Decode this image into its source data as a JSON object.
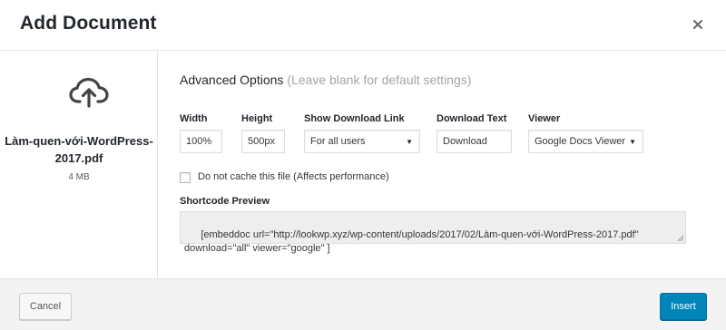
{
  "dialog": {
    "title": "Add Document",
    "close_icon": "close-icon"
  },
  "file": {
    "icon": "cloud-upload-icon",
    "name": "Làm-quen-với-WordPress-2017.pdf",
    "size": "4 MB"
  },
  "advanced": {
    "title": "Advanced Options",
    "hint": "(Leave blank for default settings)"
  },
  "fields": {
    "width": {
      "label": "Width",
      "value": "100%"
    },
    "height": {
      "label": "Height",
      "value": "500px"
    },
    "show_download": {
      "label": "Show Download Link",
      "value": "For all users"
    },
    "download_text": {
      "label": "Download Text",
      "value": "Download"
    },
    "viewer": {
      "label": "Viewer",
      "value": "Google Docs Viewer"
    }
  },
  "cache": {
    "label": "Do not cache this file (Affects performance)",
    "checked": false
  },
  "shortcode": {
    "label": "Shortcode Preview",
    "value": "[embeddoc url=\"http://lookwp.xyz/wp-content/uploads/2017/02/Làm-quen-với-WordPress-2017.pdf\"\ndownload=\"all\" viewer=\"google\" ]"
  },
  "footer": {
    "cancel_label": "Cancel",
    "insert_label": "Insert"
  },
  "colors": {
    "primary": "#0085ba",
    "hint": "#a0a5aa",
    "footer_bg": "#f3f3f3"
  }
}
